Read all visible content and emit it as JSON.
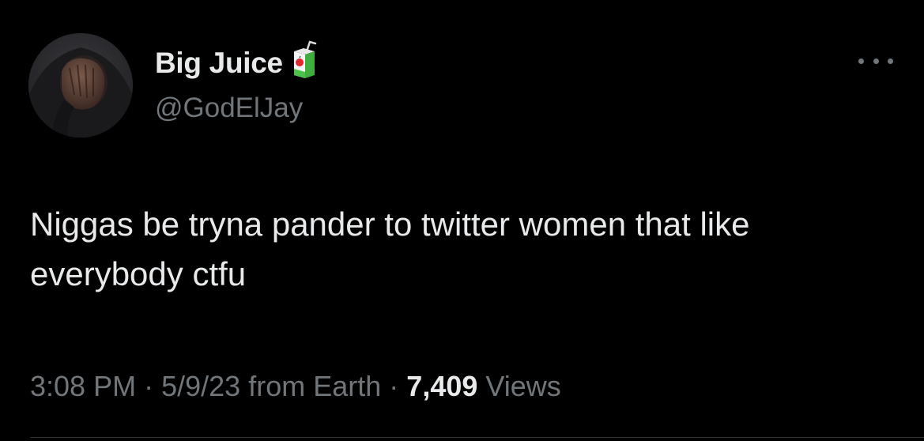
{
  "author": {
    "display_name": "Big Juice",
    "handle": "@GodElJay",
    "name_emoji": "juice-box-icon"
  },
  "tweet": {
    "text": "Niggas be tryna pander to twitter women that like everybody ctfu"
  },
  "meta": {
    "time": "3:08 PM",
    "separator": "·",
    "date": "5/9/23",
    "source": "from Earth",
    "views_count": "7,409",
    "views_label": "Views"
  },
  "colors": {
    "background": "#000000",
    "primary_text": "#e7e9ea",
    "secondary_text": "#71767b",
    "divider": "#2f3336"
  }
}
